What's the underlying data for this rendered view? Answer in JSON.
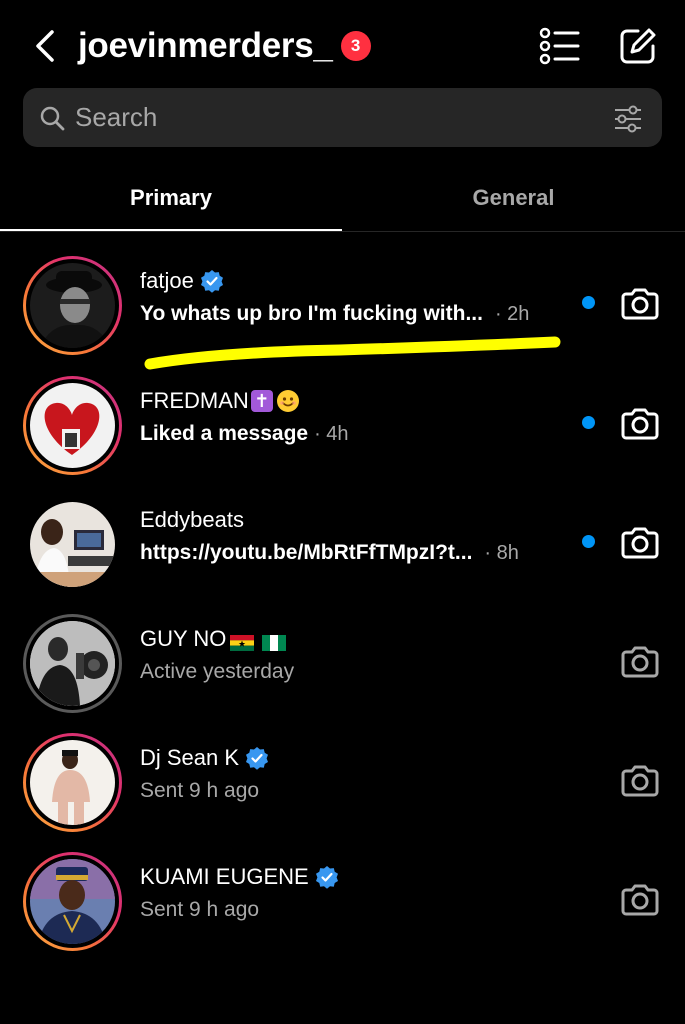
{
  "header": {
    "username": "joevinmerders_",
    "notification_count": "3"
  },
  "search": {
    "placeholder": "Search"
  },
  "tabs": [
    {
      "label": "Primary",
      "active": true
    },
    {
      "label": "General",
      "active": false
    }
  ],
  "threads": [
    {
      "name": "fatjoe",
      "verified": true,
      "preview": "Yo whats up bro I'm fucking with...",
      "time": "· 2h",
      "unread": true
    },
    {
      "name": "FREDMAN",
      "verified": false,
      "emojis": [
        "latin-cross",
        "smiling-face"
      ],
      "preview": "Liked a message",
      "time": "· 4h",
      "unread": true
    },
    {
      "name": "Eddybeats",
      "verified": false,
      "preview": "https://youtu.be/MbRtFfTMpzI?t...",
      "time": "· 8h",
      "unread": true
    },
    {
      "name": "GUY NO",
      "verified": false,
      "emojis": [
        "ghana-flag",
        "nigeria-flag"
      ],
      "preview": "Active yesterday",
      "time": "",
      "unread": false
    },
    {
      "name": "Dj Sean K",
      "verified": true,
      "preview": "Sent 9 h ago",
      "time": "",
      "unread": false
    },
    {
      "name": "KUAMI EUGENE",
      "verified": true,
      "preview": "Sent 9 h ago",
      "time": "",
      "unread": false
    }
  ],
  "colors": {
    "background": "#000000",
    "search_bg": "#262626",
    "unread_dot": "#0095f6",
    "badge": "#ff3040",
    "highlight_stroke": "#ffff00"
  }
}
